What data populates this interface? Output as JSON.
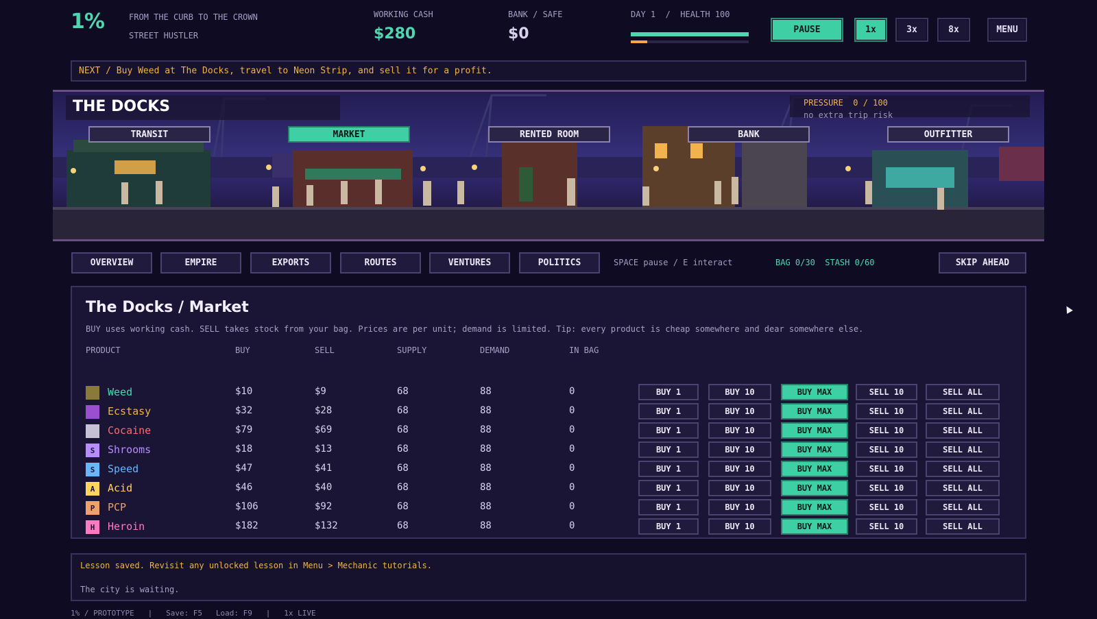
{
  "header": {
    "logo": "1%",
    "tagline": "FROM THE CURB TO THE CROWN",
    "rank": "STREET HUSTLER",
    "cash_label": "WORKING CASH",
    "cash_value": "$280",
    "bank_label": "BANK / SAFE",
    "bank_value": "$0",
    "day_health": "DAY 1  /  HEALTH 100",
    "health_fraction": 1.0,
    "day_progress_fraction": 0.14,
    "pause": "PAUSE",
    "speed_1x": "1x",
    "speed_3x": "3x",
    "speed_8x": "8x",
    "menu": "MENU"
  },
  "next_banner": "NEXT / Buy Weed at The Docks, travel to Neon Strip, and sell it for a profit.",
  "location": {
    "title": "THE DOCKS",
    "buttons": [
      "TRANSIT",
      "MARKET",
      "RENTED ROOM",
      "BANK",
      "OUTFITTER"
    ],
    "active": "MARKET",
    "pressure_title": "PRESSURE  0 / 100",
    "pressure_sub": "no extra trip risk"
  },
  "nav": {
    "overview": "OVERVIEW",
    "empire": "EMPIRE",
    "exports": "EXPORTS",
    "routes": "ROUTES",
    "ventures": "VENTURES",
    "politics": "POLITICS",
    "hint": "SPACE pause / E interact",
    "bag_stash": "BAG 0/30  STASH 0/60",
    "skip": "SKIP AHEAD"
  },
  "market": {
    "title": "The Docks / Market",
    "description": "BUY uses working cash. SELL takes stock from your bag. Prices are per unit; demand is limited. Tip: every product is cheap somewhere and dear somewhere else.",
    "columns": [
      "PRODUCT",
      "BUY",
      "SELL",
      "SUPPLY",
      "DEMAND",
      "IN BAG"
    ],
    "actions": [
      "BUY 1",
      "BUY 10",
      "BUY MAX",
      "SELL 10",
      "SELL ALL"
    ],
    "rows": [
      {
        "name": "Weed",
        "buy": "$10",
        "sell": "$9",
        "supply": "68",
        "demand": "88",
        "bag": "0",
        "color": "#4fd6b0",
        "icon": "weed-icon",
        "glyph": "",
        "icon_bg": "#8a7a3a"
      },
      {
        "name": "Ecstasy",
        "buy": "$32",
        "sell": "$28",
        "supply": "68",
        "demand": "88",
        "bag": "0",
        "color": "#f0b34c",
        "icon": "ecstasy-icon",
        "glyph": "",
        "icon_bg": "#9a4fd0"
      },
      {
        "name": "Cocaine",
        "buy": "$79",
        "sell": "$69",
        "supply": "68",
        "demand": "88",
        "bag": "0",
        "color": "#ff6b6b",
        "icon": "cocaine-icon",
        "glyph": "",
        "icon_bg": "#c7c1d6"
      },
      {
        "name": "Shrooms",
        "buy": "$18",
        "sell": "$13",
        "supply": "68",
        "demand": "88",
        "bag": "0",
        "color": "#b78cff",
        "icon": "shrooms-icon",
        "glyph": "S",
        "icon_bg": "#b78cff"
      },
      {
        "name": "Speed",
        "buy": "$47",
        "sell": "$41",
        "supply": "68",
        "demand": "88",
        "bag": "0",
        "color": "#67b7ff",
        "icon": "speed-icon",
        "glyph": "S",
        "icon_bg": "#67b7ff"
      },
      {
        "name": "Acid",
        "buy": "$46",
        "sell": "$40",
        "supply": "68",
        "demand": "88",
        "bag": "0",
        "color": "#ffd45a",
        "icon": "acid-icon",
        "glyph": "A",
        "icon_bg": "#ffd45a"
      },
      {
        "name": "PCP",
        "buy": "$106",
        "sell": "$92",
        "supply": "68",
        "demand": "88",
        "bag": "0",
        "color": "#f0a06a",
        "icon": "pcp-icon",
        "glyph": "P",
        "icon_bg": "#f0a06a"
      },
      {
        "name": "Heroin",
        "buy": "$182",
        "sell": "$132",
        "supply": "68",
        "demand": "88",
        "bag": "0",
        "color": "#ff7ac0",
        "icon": "heroin-icon",
        "glyph": "H",
        "icon_bg": "#ff7ac0"
      }
    ]
  },
  "log": {
    "line1": "Lesson saved. Revisit any unlocked lesson in Menu > Mechanic tutorials.",
    "line2": "The city is waiting."
  },
  "footer": "1% / PROTOTYPE   |   Save: F5   Load: F9   |   1x LIVE"
}
